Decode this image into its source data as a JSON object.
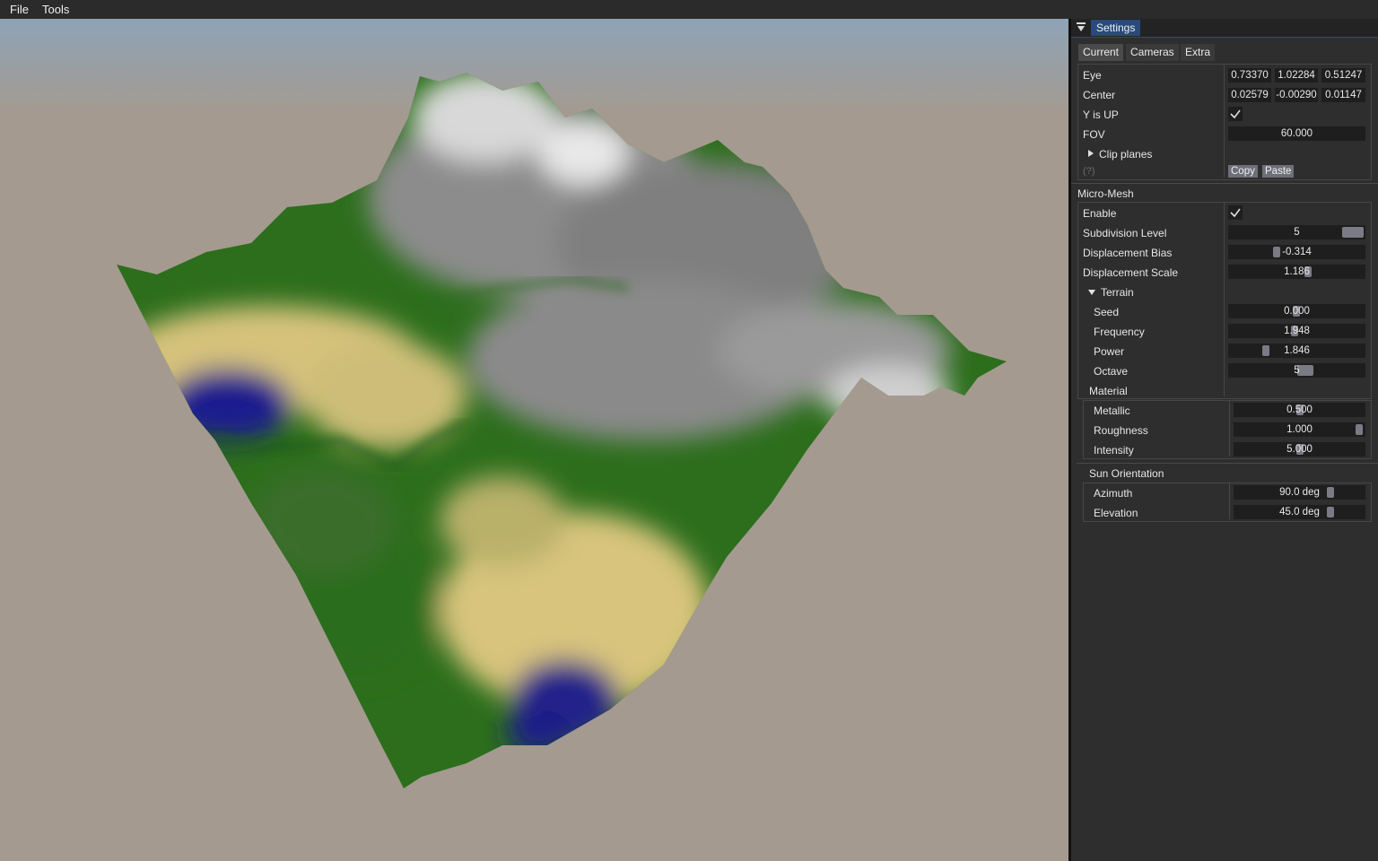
{
  "menu": {
    "file": "File",
    "tools": "Tools"
  },
  "panel": {
    "title": "Settings",
    "tabs": [
      "Current",
      "Cameras",
      "Extra"
    ],
    "camera": {
      "eye_label": "Eye",
      "eye": [
        "0.73370",
        "1.02284",
        "0.51247"
      ],
      "center_label": "Center",
      "center": [
        "0.02579",
        "-0.00290",
        "0.01147"
      ],
      "yup_label": "Y is UP",
      "yup_checked": true,
      "fov_label": "FOV",
      "fov": "60.000",
      "clip_label": "Clip planes",
      "help": "(?)",
      "copy": "Copy",
      "paste": "Paste"
    },
    "micromesh": {
      "header": "Micro-Mesh",
      "enable_label": "Enable",
      "enable_checked": true,
      "subdiv_label": "Subdivision Level",
      "subdiv": "5",
      "bias_label": "Displacement Bias",
      "bias": "-0.314",
      "scale_label": "Displacement Scale",
      "scale": "1.186",
      "terrain_header": "Terrain",
      "seed_label": "Seed",
      "seed": "0.000",
      "freq_label": "Frequency",
      "freq": "1.948",
      "power_label": "Power",
      "power": "1.846",
      "octave_label": "Octave",
      "octave": "5"
    },
    "material": {
      "header": "Material",
      "metallic_label": "Metallic",
      "metallic": "0.500",
      "roughness_label": "Roughness",
      "roughness": "1.000",
      "intensity_label": "Intensity",
      "intensity": "5.000"
    },
    "sun": {
      "header": "Sun Orientation",
      "azimuth_label": "Azimuth",
      "azimuth": "90.0 deg",
      "elevation_label": "Elevation",
      "elevation": "45.0 deg"
    }
  },
  "colors": {
    "terrain_green": "#2a6e1a",
    "terrain_sand": "#d9c27e",
    "terrain_water": "#1a1a8c",
    "terrain_rock": "#8a8a8a",
    "accent": "#294a7a"
  }
}
